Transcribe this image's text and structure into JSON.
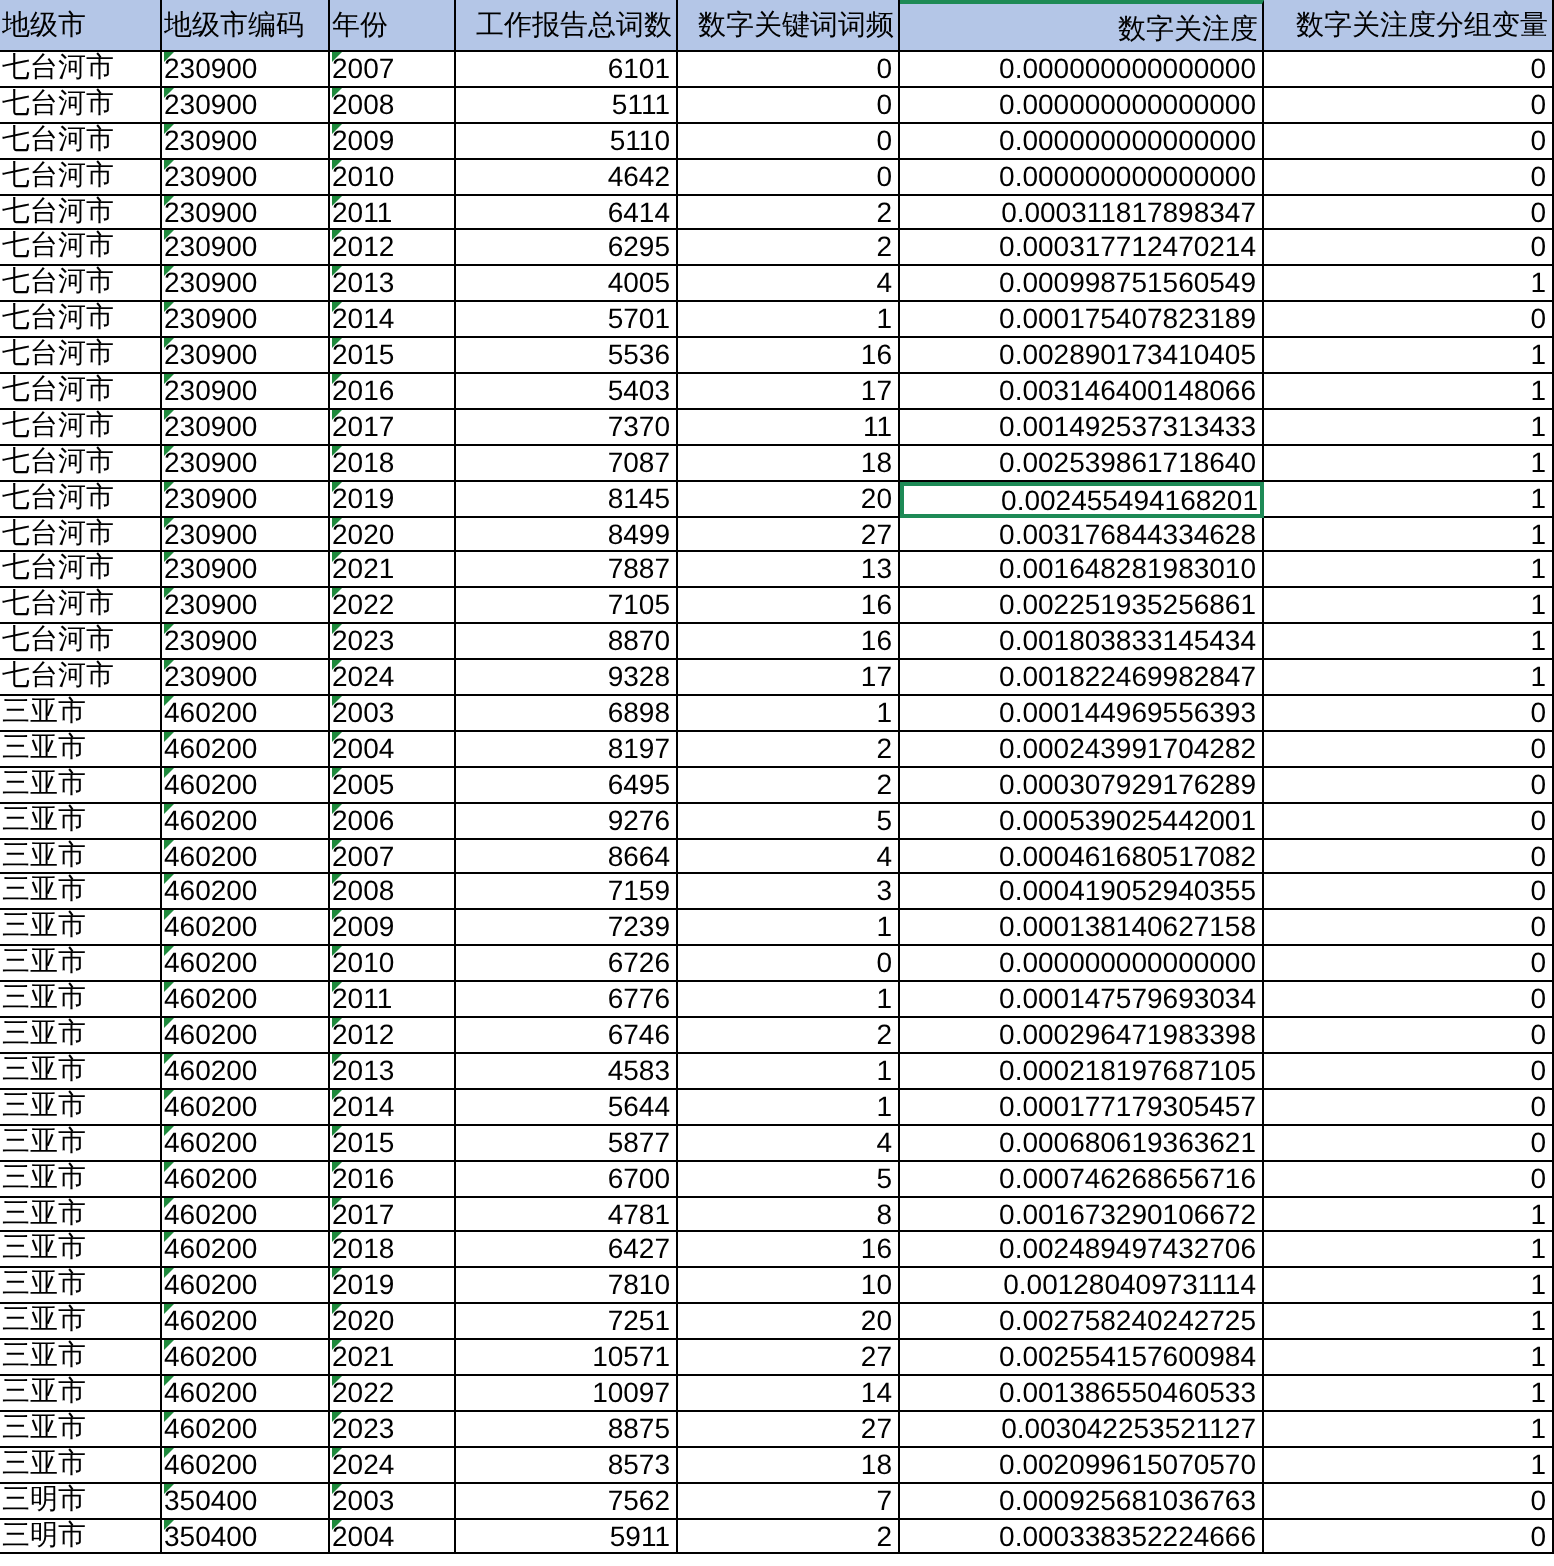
{
  "columns": [
    {
      "label": "地级市",
      "kind": "text",
      "flagged": false,
      "selected": false
    },
    {
      "label": "地级市编码",
      "kind": "text",
      "flagged": true,
      "selected": false
    },
    {
      "label": "年份",
      "kind": "text",
      "flagged": true,
      "selected": false
    },
    {
      "label": "工作报告总词数",
      "kind": "number",
      "flagged": false,
      "selected": false
    },
    {
      "label": "数字关键词词频",
      "kind": "number",
      "flagged": false,
      "selected": false
    },
    {
      "label": "数字关注度",
      "kind": "number",
      "flagged": false,
      "selected": true
    },
    {
      "label": "数字关注度分组变量",
      "kind": "number",
      "flagged": false,
      "selected": false
    }
  ],
  "rows": [
    {
      "selected": false,
      "values": [
        "七台河市",
        "230900",
        "2007",
        "6101",
        "0",
        "0.000000000000000",
        "0"
      ]
    },
    {
      "selected": false,
      "values": [
        "七台河市",
        "230900",
        "2008",
        "5111",
        "0",
        "0.000000000000000",
        "0"
      ]
    },
    {
      "selected": false,
      "values": [
        "七台河市",
        "230900",
        "2009",
        "5110",
        "0",
        "0.000000000000000",
        "0"
      ]
    },
    {
      "selected": false,
      "values": [
        "七台河市",
        "230900",
        "2010",
        "4642",
        "0",
        "0.000000000000000",
        "0"
      ]
    },
    {
      "selected": false,
      "values": [
        "七台河市",
        "230900",
        "2011",
        "6414",
        "2",
        "0.000311817898347",
        "0"
      ]
    },
    {
      "selected": false,
      "values": [
        "七台河市",
        "230900",
        "2012",
        "6295",
        "2",
        "0.000317712470214",
        "0"
      ]
    },
    {
      "selected": false,
      "values": [
        "七台河市",
        "230900",
        "2013",
        "4005",
        "4",
        "0.000998751560549",
        "1"
      ]
    },
    {
      "selected": false,
      "values": [
        "七台河市",
        "230900",
        "2014",
        "5701",
        "1",
        "0.000175407823189",
        "0"
      ]
    },
    {
      "selected": false,
      "values": [
        "七台河市",
        "230900",
        "2015",
        "5536",
        "16",
        "0.002890173410405",
        "1"
      ]
    },
    {
      "selected": false,
      "values": [
        "七台河市",
        "230900",
        "2016",
        "5403",
        "17",
        "0.003146400148066",
        "1"
      ]
    },
    {
      "selected": false,
      "values": [
        "七台河市",
        "230900",
        "2017",
        "7370",
        "11",
        "0.001492537313433",
        "1"
      ]
    },
    {
      "selected": false,
      "values": [
        "七台河市",
        "230900",
        "2018",
        "7087",
        "18",
        "0.002539861718640",
        "1"
      ]
    },
    {
      "selected": true,
      "values": [
        "七台河市",
        "230900",
        "2019",
        "8145",
        "20",
        "0.002455494168201",
        "1"
      ]
    },
    {
      "selected": false,
      "values": [
        "七台河市",
        "230900",
        "2020",
        "8499",
        "27",
        "0.003176844334628",
        "1"
      ]
    },
    {
      "selected": false,
      "values": [
        "七台河市",
        "230900",
        "2021",
        "7887",
        "13",
        "0.001648281983010",
        "1"
      ]
    },
    {
      "selected": false,
      "values": [
        "七台河市",
        "230900",
        "2022",
        "7105",
        "16",
        "0.002251935256861",
        "1"
      ]
    },
    {
      "selected": false,
      "values": [
        "七台河市",
        "230900",
        "2023",
        "8870",
        "16",
        "0.001803833145434",
        "1"
      ]
    },
    {
      "selected": false,
      "values": [
        "七台河市",
        "230900",
        "2024",
        "9328",
        "17",
        "0.001822469982847",
        "1"
      ]
    },
    {
      "selected": false,
      "values": [
        "三亚市",
        "460200",
        "2003",
        "6898",
        "1",
        "0.000144969556393",
        "0"
      ]
    },
    {
      "selected": false,
      "values": [
        "三亚市",
        "460200",
        "2004",
        "8197",
        "2",
        "0.000243991704282",
        "0"
      ]
    },
    {
      "selected": false,
      "values": [
        "三亚市",
        "460200",
        "2005",
        "6495",
        "2",
        "0.000307929176289",
        "0"
      ]
    },
    {
      "selected": false,
      "values": [
        "三亚市",
        "460200",
        "2006",
        "9276",
        "5",
        "0.000539025442001",
        "0"
      ]
    },
    {
      "selected": false,
      "values": [
        "三亚市",
        "460200",
        "2007",
        "8664",
        "4",
        "0.000461680517082",
        "0"
      ]
    },
    {
      "selected": false,
      "values": [
        "三亚市",
        "460200",
        "2008",
        "7159",
        "3",
        "0.000419052940355",
        "0"
      ]
    },
    {
      "selected": false,
      "values": [
        "三亚市",
        "460200",
        "2009",
        "7239",
        "1",
        "0.000138140627158",
        "0"
      ]
    },
    {
      "selected": false,
      "values": [
        "三亚市",
        "460200",
        "2010",
        "6726",
        "0",
        "0.000000000000000",
        "0"
      ]
    },
    {
      "selected": false,
      "values": [
        "三亚市",
        "460200",
        "2011",
        "6776",
        "1",
        "0.000147579693034",
        "0"
      ]
    },
    {
      "selected": false,
      "values": [
        "三亚市",
        "460200",
        "2012",
        "6746",
        "2",
        "0.000296471983398",
        "0"
      ]
    },
    {
      "selected": false,
      "values": [
        "三亚市",
        "460200",
        "2013",
        "4583",
        "1",
        "0.000218197687105",
        "0"
      ]
    },
    {
      "selected": false,
      "values": [
        "三亚市",
        "460200",
        "2014",
        "5644",
        "1",
        "0.000177179305457",
        "0"
      ]
    },
    {
      "selected": false,
      "values": [
        "三亚市",
        "460200",
        "2015",
        "5877",
        "4",
        "0.000680619363621",
        "0"
      ]
    },
    {
      "selected": false,
      "values": [
        "三亚市",
        "460200",
        "2016",
        "6700",
        "5",
        "0.000746268656716",
        "0"
      ]
    },
    {
      "selected": false,
      "values": [
        "三亚市",
        "460200",
        "2017",
        "4781",
        "8",
        "0.001673290106672",
        "1"
      ]
    },
    {
      "selected": false,
      "values": [
        "三亚市",
        "460200",
        "2018",
        "6427",
        "16",
        "0.002489497432706",
        "1"
      ]
    },
    {
      "selected": false,
      "values": [
        "三亚市",
        "460200",
        "2019",
        "7810",
        "10",
        "0.001280409731114",
        "1"
      ]
    },
    {
      "selected": false,
      "values": [
        "三亚市",
        "460200",
        "2020",
        "7251",
        "20",
        "0.002758240242725",
        "1"
      ]
    },
    {
      "selected": false,
      "values": [
        "三亚市",
        "460200",
        "2021",
        "10571",
        "27",
        "0.002554157600984",
        "1"
      ]
    },
    {
      "selected": false,
      "values": [
        "三亚市",
        "460200",
        "2022",
        "10097",
        "14",
        "0.001386550460533",
        "1"
      ]
    },
    {
      "selected": false,
      "values": [
        "三亚市",
        "460200",
        "2023",
        "8875",
        "27",
        "0.003042253521127",
        "1"
      ]
    },
    {
      "selected": false,
      "values": [
        "三亚市",
        "460200",
        "2024",
        "8573",
        "18",
        "0.002099615070570",
        "1"
      ]
    },
    {
      "selected": false,
      "values": [
        "三明市",
        "350400",
        "2003",
        "7562",
        "7",
        "0.000925681036763",
        "0"
      ]
    },
    {
      "selected": false,
      "values": [
        "三明市",
        "350400",
        "2004",
        "5911",
        "2",
        "0.000338352224666",
        "0"
      ]
    }
  ]
}
